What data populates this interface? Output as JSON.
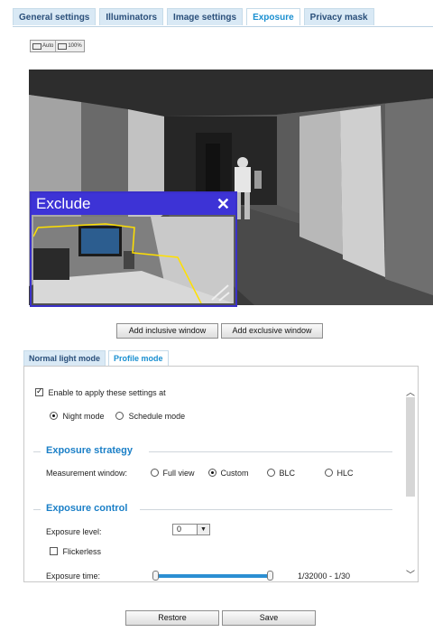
{
  "tabs": [
    "General settings",
    "Illuminators",
    "Image settings",
    "Exposure",
    "Privacy mask"
  ],
  "active_tab": "Exposure",
  "view_buttons": {
    "auto": "Auto",
    "full": "100%"
  },
  "exclude_window": {
    "title": "Exclude",
    "close_glyph": "✕"
  },
  "window_buttons": {
    "inclusive": "Add inclusive window",
    "exclusive": "Add exclusive window"
  },
  "mode_tabs": [
    "Normal light mode",
    "Profile mode"
  ],
  "active_mode_tab": "Profile mode",
  "profile": {
    "enable_label": "Enable to apply these settings at",
    "enable_checked": true,
    "night_mode": "Night mode",
    "schedule_mode": "Schedule mode",
    "selected_mode": "Night mode"
  },
  "exposure_strategy": {
    "title": "Exposure strategy",
    "measurement_label": "Measurement window:",
    "options": [
      "Full view",
      "Custom",
      "BLC",
      "HLC"
    ],
    "selected": "Custom"
  },
  "exposure_control": {
    "title": "Exposure control",
    "level_label": "Exposure level:",
    "level_value": "0",
    "flickerless_label": "Flickerless",
    "flickerless_checked": false,
    "time_label": "Exposure time:",
    "time_value": "1/32000 - 1/30"
  },
  "footer": {
    "restore": "Restore",
    "save": "Save"
  },
  "colors": {
    "accent": "#1a8fd0",
    "exclude": "#3d33d6",
    "slider": "#2b8fd3"
  }
}
